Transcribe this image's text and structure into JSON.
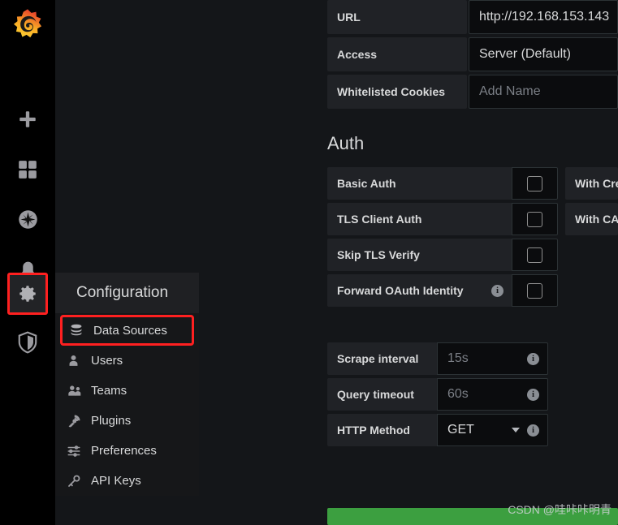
{
  "app": {
    "name": "Grafana",
    "logo_icon": "grafana-logo-icon"
  },
  "navrail": {
    "items": [
      {
        "id": "create",
        "icon": "plus-icon",
        "label": "Create"
      },
      {
        "id": "dashboards",
        "icon": "dashboards-grid-icon",
        "label": "Dashboards"
      },
      {
        "id": "explore",
        "icon": "compass-icon",
        "label": "Explore"
      },
      {
        "id": "alerting",
        "icon": "bell-icon",
        "label": "Alerting"
      },
      {
        "id": "configuration",
        "icon": "gear-icon",
        "label": "Configuration",
        "highlighted": true
      },
      {
        "id": "server-admin",
        "icon": "shield-icon",
        "label": "Server Admin"
      }
    ]
  },
  "config_menu": {
    "title": "Configuration",
    "items": [
      {
        "label": "Data Sources",
        "icon": "database-icon",
        "highlighted": true
      },
      {
        "label": "Users",
        "icon": "user-icon",
        "highlighted": false
      },
      {
        "label": "Teams",
        "icon": "users-icon",
        "highlighted": false
      },
      {
        "label": "Plugins",
        "icon": "plugin-icon",
        "highlighted": false
      },
      {
        "label": "Preferences",
        "icon": "sliders-icon",
        "highlighted": false
      },
      {
        "label": "API Keys",
        "icon": "key-icon",
        "highlighted": false
      }
    ]
  },
  "form": {
    "http_rows": [
      {
        "label": "URL",
        "value": "http://192.168.153.143",
        "is_placeholder": false
      },
      {
        "label": "Access",
        "value": "Server (Default)",
        "is_placeholder": false
      },
      {
        "label": "Whitelisted Cookies",
        "value": "Add Name",
        "is_placeholder": true
      }
    ],
    "auth": {
      "title": "Auth",
      "rows": [
        {
          "label": "Basic Auth",
          "checked": false,
          "has_info": false,
          "side_label": "With Credentials"
        },
        {
          "label": "TLS Client Auth",
          "checked": false,
          "has_info": false,
          "side_label": "With CA Cert"
        },
        {
          "label": "Skip TLS Verify",
          "checked": false,
          "has_info": false,
          "side_label": ""
        },
        {
          "label": "Forward OAuth Identity",
          "checked": false,
          "has_info": true,
          "side_label": ""
        }
      ]
    },
    "settings": [
      {
        "label": "Scrape interval",
        "value": "15s",
        "is_placeholder": true,
        "has_caret": false,
        "has_info": true
      },
      {
        "label": "Query timeout",
        "value": "60s",
        "is_placeholder": true,
        "has_caret": false,
        "has_info": true
      },
      {
        "label": "HTTP Method",
        "value": "GET",
        "is_placeholder": false,
        "has_caret": true,
        "has_info": true
      }
    ]
  },
  "save_button": {
    "label": "",
    "color": "#3c9f40"
  },
  "watermark": {
    "text": "CSDN @哇咔咔明青"
  },
  "colors": {
    "highlight_red": "#ff2020",
    "panel_bg": "#202226",
    "input_bg": "#0b0c0e",
    "text": "#d8d9da",
    "accent_green": "#3c9f40",
    "logo_orange": "#f05a28"
  }
}
